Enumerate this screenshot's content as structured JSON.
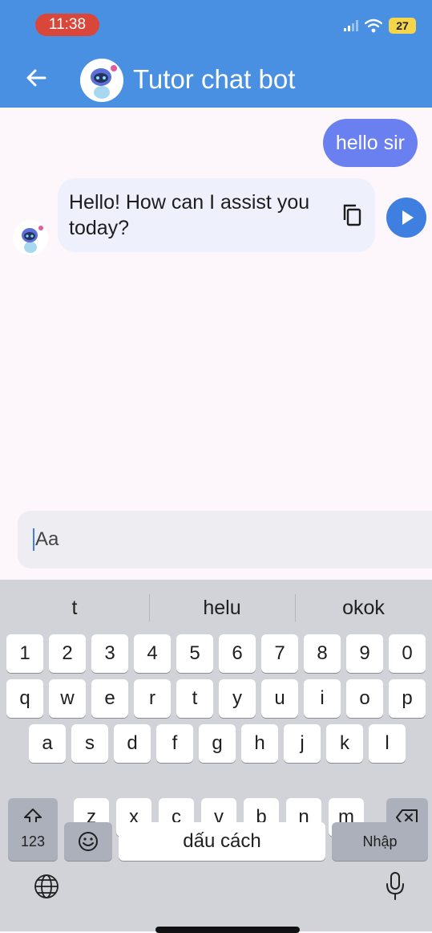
{
  "status": {
    "time": "11:38",
    "battery": "27"
  },
  "header": {
    "title": "Tutor chat bot"
  },
  "messages": [
    {
      "role": "user",
      "text": "hello sir"
    },
    {
      "role": "bot",
      "text": "Hello! How can I assist you today?"
    }
  ],
  "input": {
    "placeholder": "Aa"
  },
  "keyboard": {
    "suggestions": [
      "t",
      "helu",
      "okok"
    ],
    "row_numbers": [
      "1",
      "2",
      "3",
      "4",
      "5",
      "6",
      "7",
      "8",
      "9",
      "0"
    ],
    "row_q": [
      "q",
      "w",
      "e",
      "r",
      "t",
      "y",
      "u",
      "i",
      "o",
      "p"
    ],
    "row_a": [
      "a",
      "s",
      "d",
      "f",
      "g",
      "h",
      "j",
      "k",
      "l"
    ],
    "row_z": [
      "z",
      "x",
      "c",
      "v",
      "b",
      "n",
      "m"
    ],
    "numbers_label": "123",
    "space_label": "dấu cách",
    "return_label": "Nhập"
  },
  "colors": {
    "appbar": "#4a90e2",
    "user_bubble": "#6a7ff0",
    "bot_bubble": "#eef1fb",
    "play_button": "#3f7fe0",
    "time_pill": "#d9473b",
    "battery": "#f5d64a"
  }
}
